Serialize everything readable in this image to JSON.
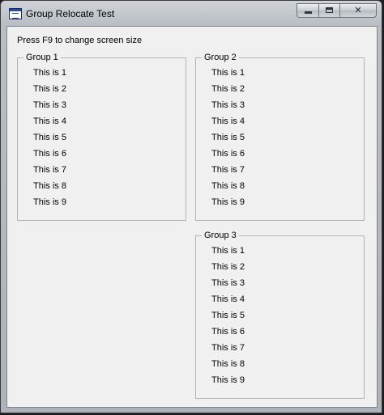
{
  "window": {
    "title": "Group Relocate Test",
    "caption_glyphs": {
      "close": "✕"
    }
  },
  "main": {
    "hint": "Press F9 to change screen size",
    "groups": [
      {
        "label": "Group 1",
        "items": [
          "This is 1",
          "This is 2",
          "This is 3",
          "This is 4",
          "This is 5",
          "This is 6",
          "This is 7",
          "This is 8",
          "This is 9"
        ]
      },
      {
        "label": "Group 2",
        "items": [
          "This is 1",
          "This is 2",
          "This is 3",
          "This is 4",
          "This is 5",
          "This is 6",
          "This is 7",
          "This is 8",
          "This is 9"
        ]
      },
      {
        "label": "Group 3",
        "items": [
          "This is 1",
          "This is 2",
          "This is 3",
          "This is 4",
          "This is 5",
          "This is 6",
          "This is 7",
          "This is 8",
          "This is 9"
        ]
      }
    ]
  }
}
